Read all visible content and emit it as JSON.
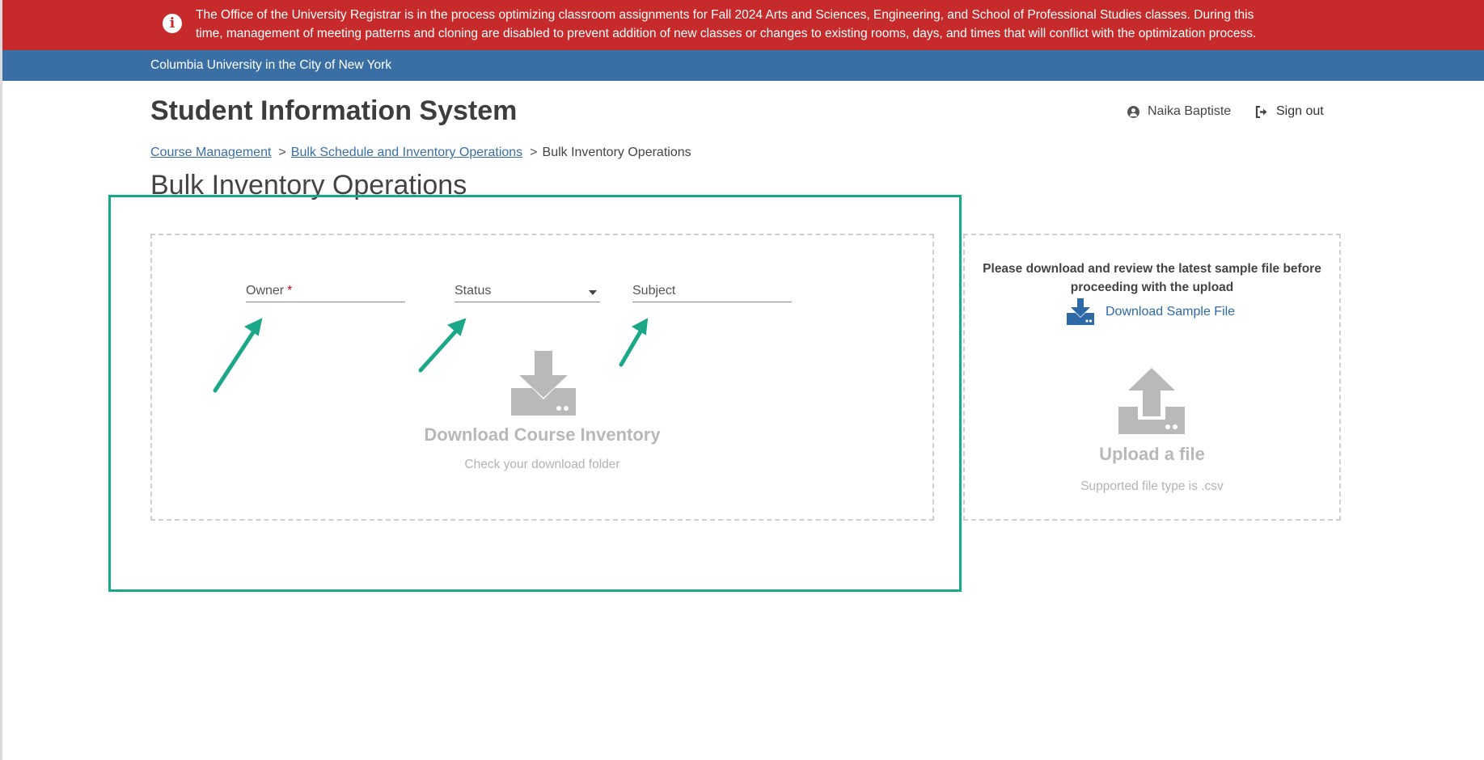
{
  "alert": {
    "icon": "info-icon",
    "text": "The Office of the University Registrar is in the process optimizing classroom assignments for Fall 2024 Arts and Sciences, Engineering, and School of Professional Studies classes. During this time, management of meeting patterns and cloning are disabled to prevent addition of new classes or changes to existing rooms, days, and times that will conflict with the optimization process.",
    "color": "#c62a2a"
  },
  "topbar": {
    "title": "Columbia University in the City of New York",
    "color": "#3a6fa5"
  },
  "header": {
    "app_title": "Student Information System",
    "user_name": "Naika Baptiste",
    "signout_label": "Sign out"
  },
  "breadcrumb": {
    "items": [
      "Course Management",
      "Bulk Schedule and Inventory Operations"
    ],
    "current": "Bulk Inventory Operations",
    "separator": ">"
  },
  "page": {
    "heading": "Bulk Inventory Operations"
  },
  "download_panel": {
    "owner_label": "Owner",
    "owner_required": "*",
    "status_label": "Status",
    "subject_label": "Subject",
    "title": "Download Course Inventory",
    "subtitle": "Check your download folder"
  },
  "upload_panel": {
    "sample_note": "Please download and review the latest sample file before proceeding with the upload",
    "sample_link": "Download Sample File",
    "title": "Upload a file",
    "subtitle": "Supported file type is .csv"
  },
  "annotation": {
    "highlight_color": "#1aa888"
  }
}
